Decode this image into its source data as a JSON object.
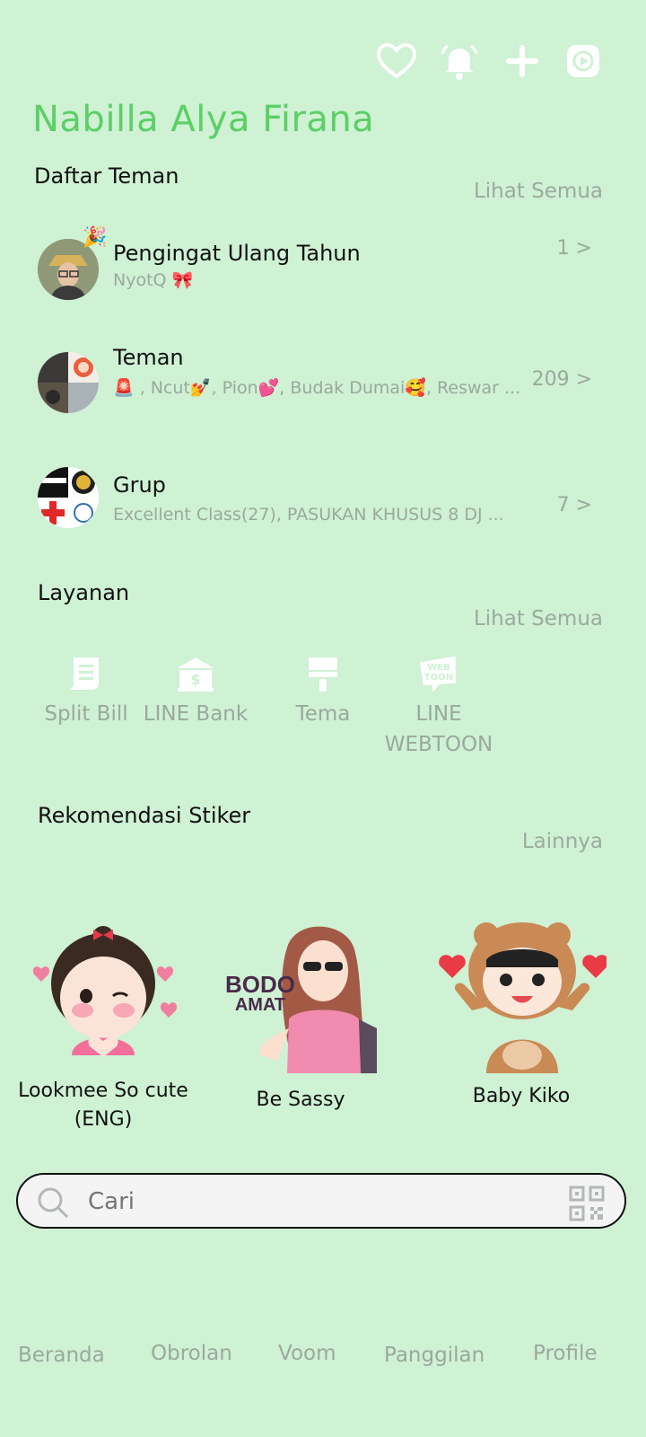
{
  "header": {
    "icons": [
      "heart-icon",
      "bell-icon",
      "plus-icon",
      "play-icon"
    ]
  },
  "profile": {
    "name": "Nabilla Alya Firana"
  },
  "friends_section": {
    "title": "Daftar Teman",
    "see_all": "Lihat Semua",
    "rows": [
      {
        "title": "Pengingat Ulang Tahun",
        "subtitle": "NyotQ 🎀",
        "count": "1 >"
      },
      {
        "title": "Teman",
        "subtitle": "🚨 , Ncut💅, Pion💕, Budak Dumai🥰, Reswar ...",
        "count": "209 >"
      },
      {
        "title": "Grup",
        "subtitle": "Excellent Class(27), PASUKAN KHUSUS 8 DJ ...",
        "count": "7 >"
      }
    ]
  },
  "services_section": {
    "title": "Layanan",
    "see_all": "Lihat Semua",
    "items": [
      {
        "label": "Split Bill"
      },
      {
        "label": "LINE Bank"
      },
      {
        "label": "Tema"
      },
      {
        "label": "LINE WEBTOON"
      }
    ]
  },
  "stickers_section": {
    "title": "Rekomendasi Stiker",
    "see_all": "Lainnya",
    "items": [
      {
        "label": "Lookmee So cute (ENG)"
      },
      {
        "label": "Be Sassy",
        "art_text_1": "BODO",
        "art_text_2": "AMAT"
      },
      {
        "label": "Baby Kiko"
      }
    ]
  },
  "search": {
    "placeholder": "Cari"
  },
  "bottom_nav": {
    "items": [
      {
        "label": "Beranda"
      },
      {
        "label": "Obrolan"
      },
      {
        "label": "Voom"
      },
      {
        "label": "Panggilan"
      },
      {
        "label": "Profile"
      }
    ]
  },
  "colors": {
    "background": "#cff1d4",
    "accent": "#5ccf66",
    "muted": "#9aa99d"
  }
}
